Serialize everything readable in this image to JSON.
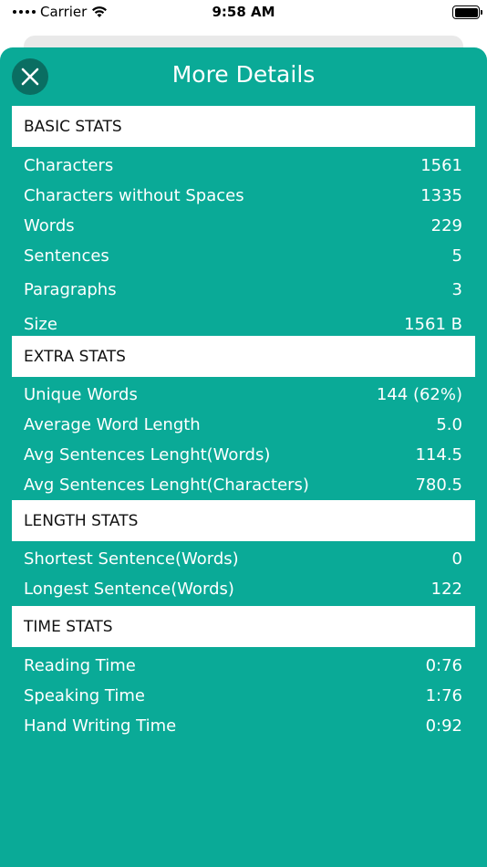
{
  "status": {
    "carrier": "Carrier",
    "time": "9:58 AM"
  },
  "sheet": {
    "title": "More Details"
  },
  "sections": [
    {
      "title": "BASIC STATS",
      "rows": [
        {
          "label": "Characters",
          "value": "1561"
        },
        {
          "label": "Characters without Spaces",
          "value": "1335"
        },
        {
          "label": "Words",
          "value": "229"
        },
        {
          "label": "Sentences",
          "value": "5"
        },
        {
          "label": "Paragraphs",
          "value": "3"
        },
        {
          "label": "Size",
          "value": "1561 B"
        }
      ]
    },
    {
      "title": "EXTRA STATS",
      "rows": [
        {
          "label": "Unique Words",
          "value": "144 (62%)"
        },
        {
          "label": "Average Word Length",
          "value": "5.0"
        },
        {
          "label": "Avg Sentences Lenght(Words)",
          "value": "114.5"
        },
        {
          "label": "Avg Sentences Lenght(Characters)",
          "value": "780.5"
        }
      ]
    },
    {
      "title": "LENGTH STATS",
      "rows": [
        {
          "label": "Shortest Sentence(Words)",
          "value": "0"
        },
        {
          "label": "Longest Sentence(Words)",
          "value": "122"
        }
      ]
    },
    {
      "title": "TIME STATS",
      "rows": [
        {
          "label": "Reading Time",
          "value": "0:76"
        },
        {
          "label": "Speaking Time",
          "value": "1:76"
        },
        {
          "label": "Hand Writing Time",
          "value": "0:92"
        }
      ]
    }
  ],
  "icons": {
    "close": "close-icon",
    "wifi": "wifi-icon",
    "battery": "battery-icon",
    "signal": "signal-dots-icon"
  },
  "colors": {
    "sheet": "#0aaa97",
    "close_button": "#0a6e62",
    "header_bg": "#ffffff"
  }
}
